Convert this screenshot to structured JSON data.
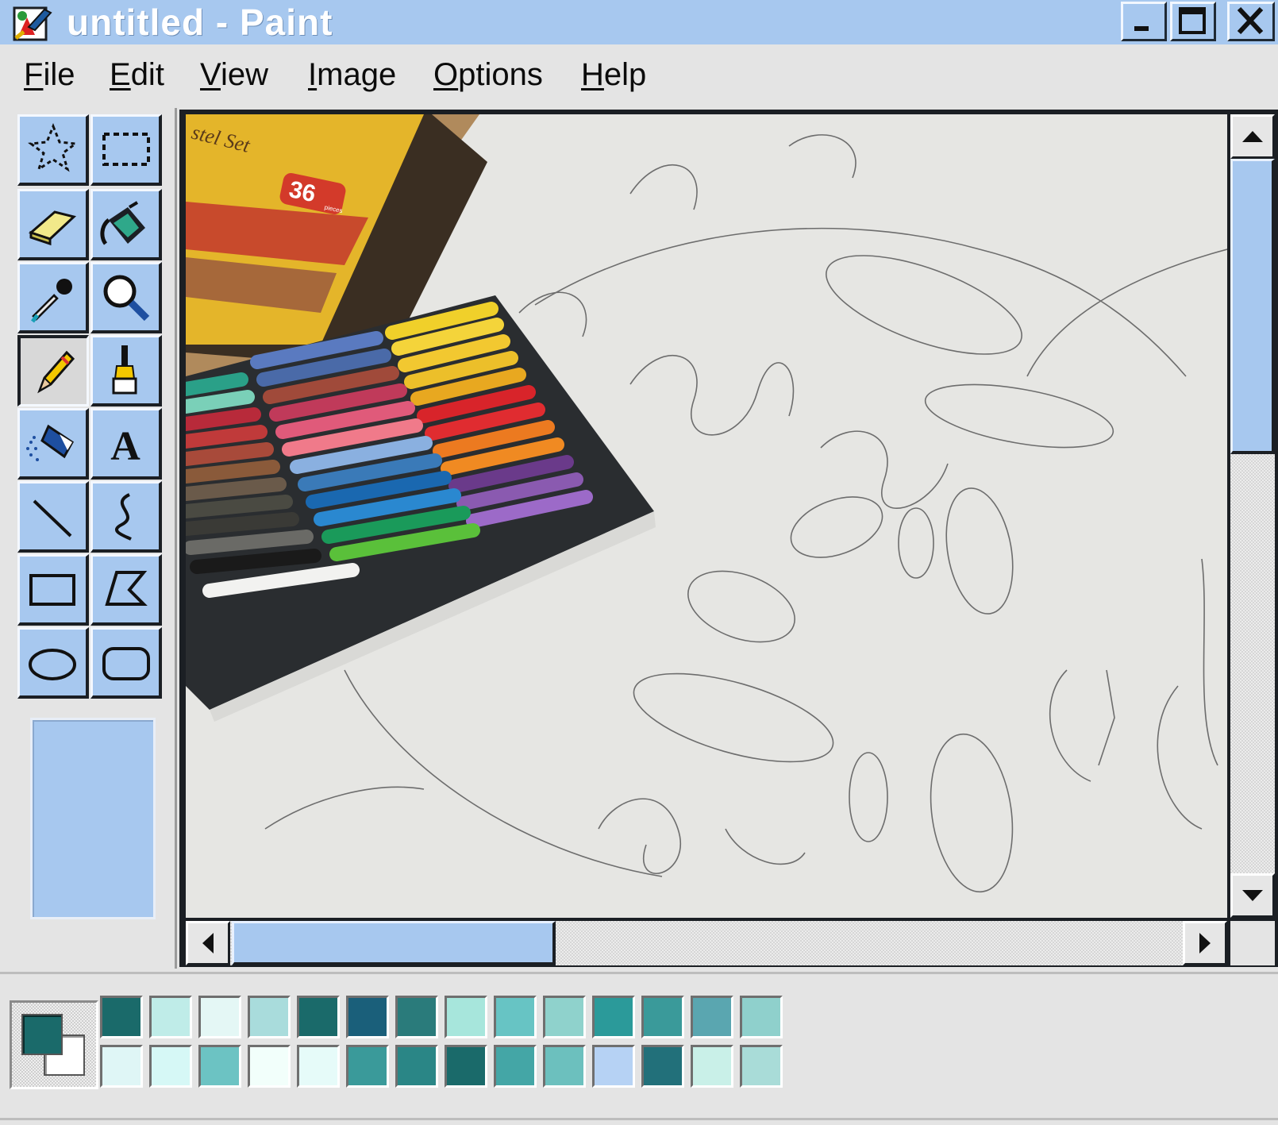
{
  "window": {
    "title": "untitled - Paint",
    "buttons": [
      "minimize",
      "maximize",
      "close"
    ]
  },
  "menu": {
    "items": [
      {
        "accel": "F",
        "rest": "ile"
      },
      {
        "accel": "E",
        "rest": "dit"
      },
      {
        "accel": "V",
        "rest": "iew"
      },
      {
        "accel": "I",
        "rest": "mage"
      },
      {
        "accel": "O",
        "rest": "ptions"
      },
      {
        "accel": "H",
        "rest": "elp"
      }
    ]
  },
  "toolbox": {
    "tools": [
      {
        "name": "free-form-select",
        "icon": "free-form-select-icon"
      },
      {
        "name": "rectangle-select",
        "icon": "rectangle-select-icon"
      },
      {
        "name": "eraser",
        "icon": "eraser-icon"
      },
      {
        "name": "fill-with-color",
        "icon": "paint-bucket-icon"
      },
      {
        "name": "pick-color",
        "icon": "eyedropper-icon"
      },
      {
        "name": "magnifier",
        "icon": "magnifier-icon"
      },
      {
        "name": "pencil",
        "icon": "pencil-icon",
        "selected": true
      },
      {
        "name": "brush",
        "icon": "brush-icon"
      },
      {
        "name": "airbrush",
        "icon": "airbrush-icon"
      },
      {
        "name": "text",
        "icon": "text-icon",
        "glyph": "A"
      },
      {
        "name": "line",
        "icon": "line-icon"
      },
      {
        "name": "curve",
        "icon": "curve-icon"
      },
      {
        "name": "rectangle",
        "icon": "rectangle-icon"
      },
      {
        "name": "polygon",
        "icon": "polygon-icon"
      },
      {
        "name": "ellipse",
        "icon": "ellipse-icon"
      },
      {
        "name": "rounded-rectangle",
        "icon": "rounded-rectangle-icon"
      }
    ]
  },
  "canvas": {
    "photo_text": {
      "box_title": "stel Set",
      "piece_count": "36",
      "piece_label": "pieces"
    }
  },
  "scroll": {
    "vertical_position": 0.0,
    "horizontal_position": 0.0
  },
  "colors": {
    "accent": "#a7c8ef",
    "foreground": "#1a6a6a",
    "background": "#ffffff",
    "palette_row1": [
      "#1a6a6a",
      "#bfece8",
      "#e4f7f5",
      "#a9dcdc",
      "#1a6a6a",
      "#1a5f7a",
      "#2a7b7b",
      "#a7e6dc",
      "#67c4c4",
      "#8fd2cc",
      "#2b9a9a",
      "#3a9a9a",
      "#5aa6b0",
      "#8fd0cc"
    ],
    "palette_row2": [
      "#dff6f6",
      "#d6f8f6",
      "#6cc3c3",
      "#f2fffb",
      "#e6fbf9",
      "#3a9a9a",
      "#2a8686",
      "#1a6a6a",
      "#44a6a6",
      "#6cc0be",
      "#b6d2f4",
      "#22707a",
      "#c9f0e8",
      "#a9dcd8"
    ]
  }
}
